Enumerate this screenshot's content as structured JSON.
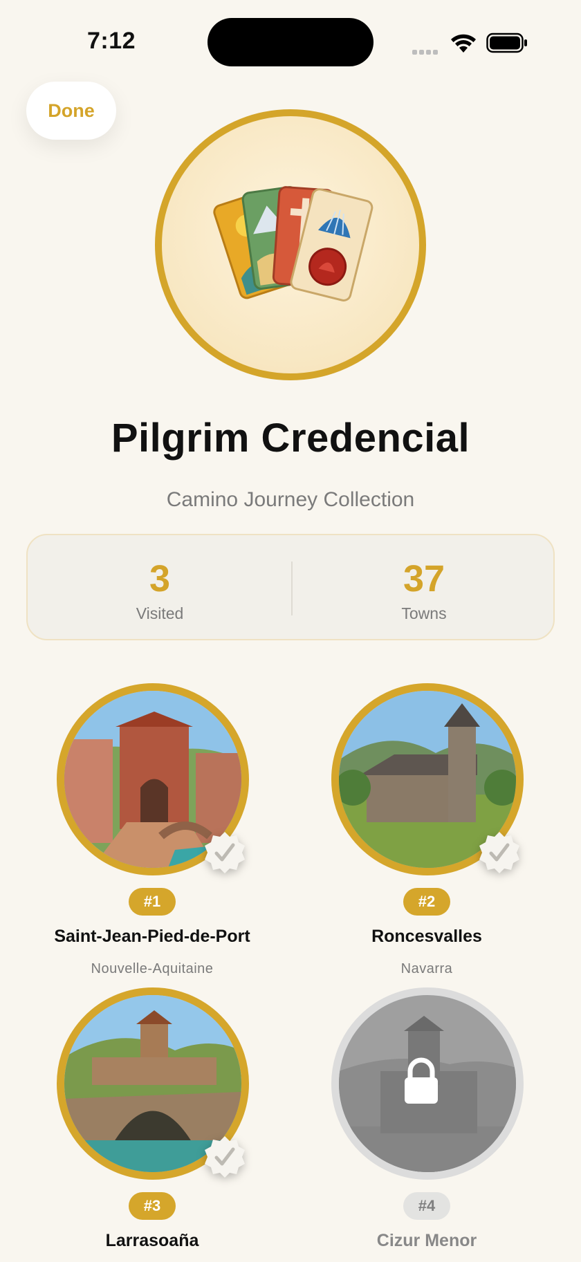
{
  "status_bar": {
    "time": "7:12"
  },
  "header": {
    "done_label": "Done"
  },
  "hero": {
    "icon": "credential-cards-icon"
  },
  "title": "Pilgrim Credencial",
  "subtitle": "Camino Journey Collection",
  "stats": [
    {
      "value": "3",
      "label": "Visited"
    },
    {
      "value": "37",
      "label": "Towns"
    }
  ],
  "towns": [
    {
      "number": "#1",
      "name": "Saint-Jean-Pied-de-Port",
      "region": "Nouvelle-Aquitaine",
      "visited": true
    },
    {
      "number": "#2",
      "name": "Roncesvalles",
      "region": "Navarra",
      "visited": true
    },
    {
      "number": "#3",
      "name": "Larrasoaña",
      "region": "",
      "visited": true
    },
    {
      "number": "#4",
      "name": "Cizur Menor",
      "region": "",
      "visited": false
    }
  ],
  "colors": {
    "accent": "#d4a42a",
    "background": "#f9f6ef",
    "locked": "#dcdcdc"
  }
}
